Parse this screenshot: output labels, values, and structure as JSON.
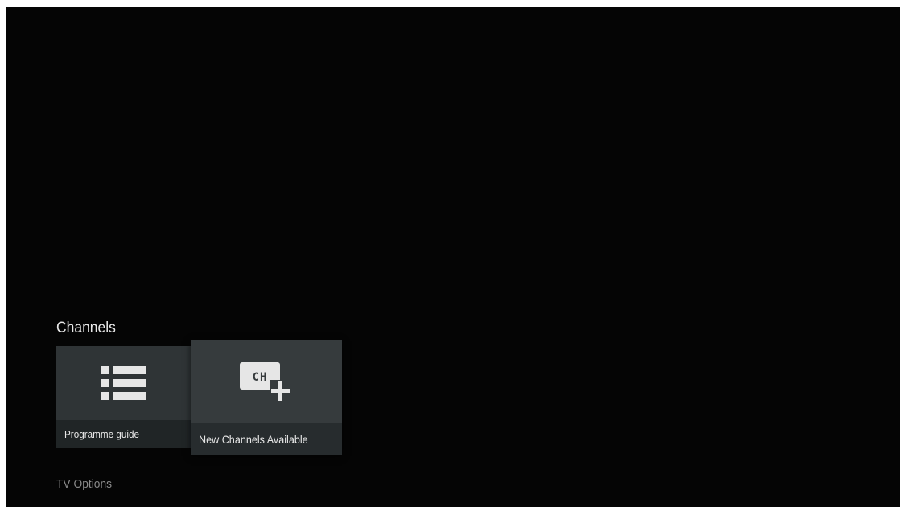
{
  "section": {
    "title": "Channels"
  },
  "cards": {
    "programme_guide": {
      "label": "Programme guide",
      "icon": "list-icon"
    },
    "new_channels": {
      "label": "New Channels Available",
      "icon": "ch-plus-icon",
      "icon_text": "CH"
    }
  },
  "next_row": {
    "label": "TV Options"
  },
  "colors": {
    "background": "#050505",
    "card": "#2f3436",
    "card_focused": "#363b3d",
    "text": "#e8e8e8",
    "muted_text": "#8a8a8a"
  }
}
